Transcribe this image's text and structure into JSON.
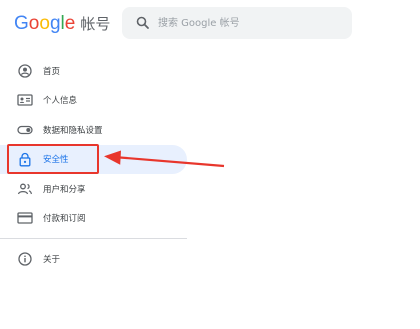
{
  "header": {
    "logo_letters": [
      {
        "ch": "G",
        "color": "#4285F4"
      },
      {
        "ch": "o",
        "color": "#EA4335"
      },
      {
        "ch": "o",
        "color": "#FBBC05"
      },
      {
        "ch": "g",
        "color": "#4285F4"
      },
      {
        "ch": "l",
        "color": "#34A853"
      },
      {
        "ch": "e",
        "color": "#EA4335"
      }
    ],
    "logo_text": "Google",
    "product": "帐号",
    "search_placeholder": "搜索 Google 帐号"
  },
  "nav": {
    "items": [
      {
        "label": "首页",
        "icon": "home-icon"
      },
      {
        "label": "个人信息",
        "icon": "id-card-icon"
      },
      {
        "label": "数据和隐私设置",
        "icon": "toggle-icon"
      },
      {
        "label": "安全性",
        "icon": "lock-icon",
        "active": true
      },
      {
        "label": "用户和分享",
        "icon": "people-icon"
      },
      {
        "label": "付款和订阅",
        "icon": "credit-card-icon"
      }
    ],
    "about": {
      "label": "关于",
      "icon": "info-icon"
    }
  },
  "colors": {
    "accent": "#1a73e8",
    "active_bg": "#e8f0fe",
    "annotation_red": "#e8362c"
  }
}
